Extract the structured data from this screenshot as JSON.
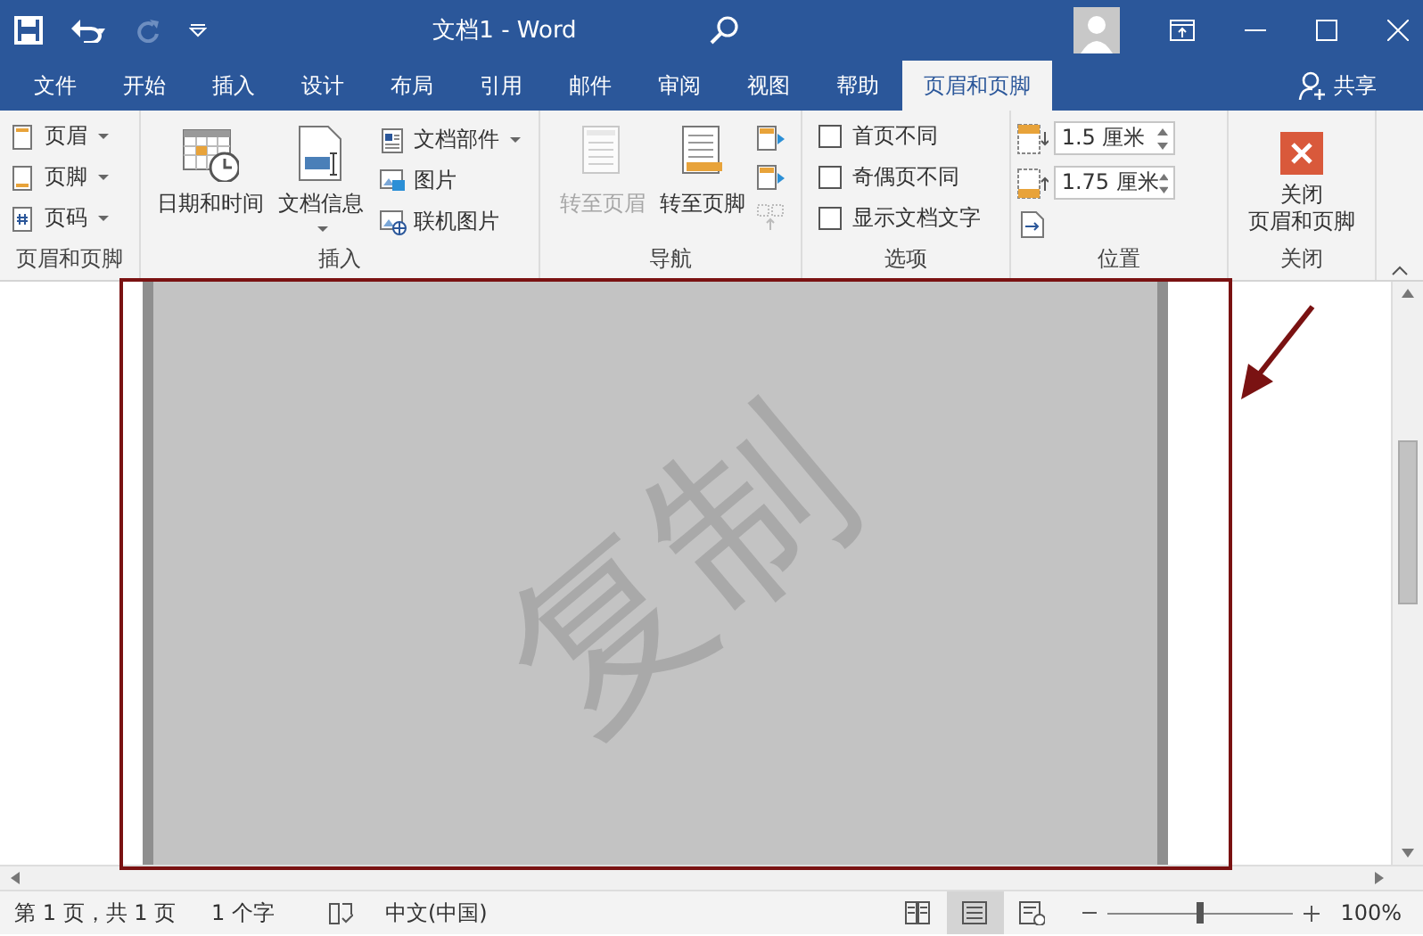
{
  "window": {
    "title": "文档1  -  Word"
  },
  "tabs": [
    {
      "label": "文件",
      "selected": false
    },
    {
      "label": "开始",
      "selected": false
    },
    {
      "label": "插入",
      "selected": false
    },
    {
      "label": "设计",
      "selected": false
    },
    {
      "label": "布局",
      "selected": false
    },
    {
      "label": "引用",
      "selected": false
    },
    {
      "label": "邮件",
      "selected": false
    },
    {
      "label": "审阅",
      "selected": false
    },
    {
      "label": "视图",
      "selected": false
    },
    {
      "label": "帮助",
      "selected": false
    },
    {
      "label": "页眉和页脚",
      "selected": true
    }
  ],
  "share": "共享",
  "ribbon": {
    "groups": [
      {
        "label": "页眉和页脚",
        "items": [
          {
            "kind": "small",
            "label": "页眉",
            "dropdown": true
          },
          {
            "kind": "small",
            "label": "页脚",
            "dropdown": true
          },
          {
            "kind": "small",
            "label": "页码",
            "dropdown": true
          }
        ]
      },
      {
        "label": "插入",
        "items": [
          {
            "kind": "large",
            "label": "日期和时间",
            "dropdown": false,
            "disabled": false
          },
          {
            "kind": "large",
            "label": "文档信息",
            "dropdown": true,
            "disabled": false
          },
          {
            "kind": "stack",
            "items": [
              {
                "kind": "small",
                "label": "文档部件",
                "dropdown": true
              },
              {
                "kind": "small",
                "label": "图片",
                "dropdown": false
              },
              {
                "kind": "small",
                "label": "联机图片",
                "dropdown": false
              }
            ]
          }
        ]
      },
      {
        "label": "导航",
        "items": [
          {
            "kind": "large",
            "label": "转至页眉",
            "dropdown": false,
            "disabled": true
          },
          {
            "kind": "large",
            "label": "转至页脚",
            "dropdown": false,
            "disabled": false
          },
          {
            "kind": "nav-icons"
          }
        ]
      },
      {
        "label": "选项",
        "items": [
          {
            "kind": "checkbox",
            "label": "首页不同",
            "checked": false
          },
          {
            "kind": "checkbox",
            "label": "奇偶页不同",
            "checked": false
          },
          {
            "kind": "checkbox",
            "label": "显示文档文字",
            "checked": false
          }
        ]
      },
      {
        "label": "位置",
        "items": [
          {
            "kind": "spin",
            "value": "1.5 厘米"
          },
          {
            "kind": "spin",
            "value": "1.75 厘米"
          },
          {
            "kind": "align-icon"
          }
        ]
      },
      {
        "label": "关闭",
        "items": [
          {
            "kind": "close",
            "lines": [
              "关闭",
              "页眉和页脚"
            ]
          }
        ]
      }
    ]
  },
  "document": {
    "watermark": "复制"
  },
  "status": {
    "page": "第 1 页，共 1 页",
    "words": "1 个字",
    "language": "中文(中国)",
    "views": [
      {
        "kind": "read",
        "selected": false
      },
      {
        "kind": "print",
        "selected": true
      },
      {
        "kind": "web",
        "selected": false
      }
    ],
    "zoom": {
      "level": 0.5,
      "percent": "100%"
    }
  }
}
